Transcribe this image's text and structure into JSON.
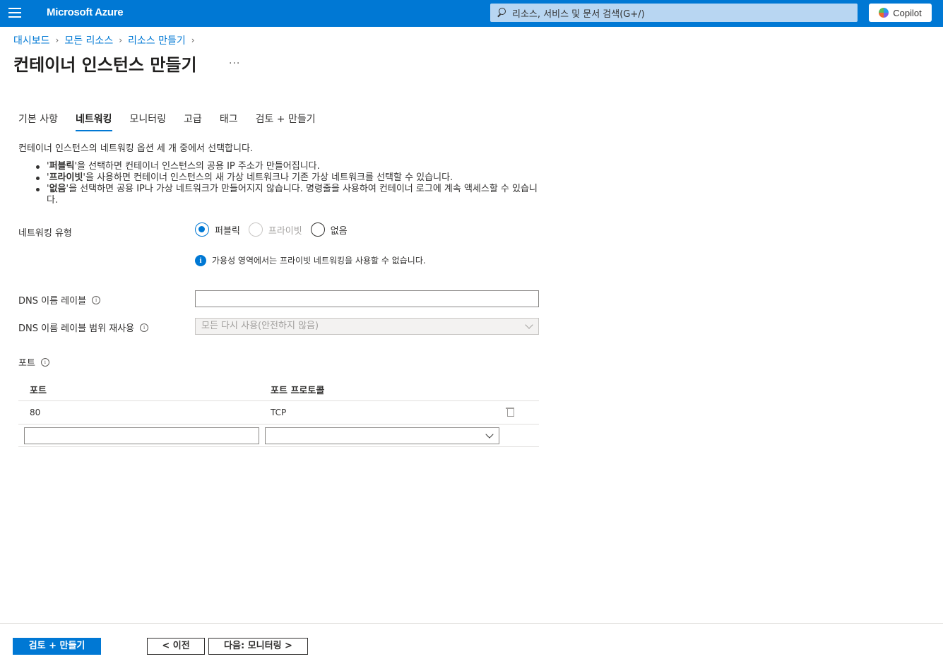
{
  "topbar": {
    "brand": "Microsoft Azure",
    "search_placeholder": "리소스, 서비스 및 문서 검색(G+/)",
    "copilot_label": "Copilot"
  },
  "breadcrumb": [
    "대시보드",
    "모든 리소스",
    "리소스 만들기"
  ],
  "page": {
    "title": "컨테이너 인스턴스 만들기",
    "more": "···"
  },
  "tabs": [
    {
      "label": "기본 사항",
      "active": false
    },
    {
      "label": "네트워킹",
      "active": true
    },
    {
      "label": "모니터링",
      "active": false
    },
    {
      "label": "고급",
      "active": false
    },
    {
      "label": "태그",
      "active": false
    },
    {
      "label": "검토 + 만들기",
      "active": false
    }
  ],
  "intro": "컨테이너 인스턴스의 네트워킹 옵션 세 개 중에서 선택합니다.",
  "bullets": [
    {
      "bold": "퍼블릭",
      "rest": "'을 선택하면 컨테이너 인스턴스의 공용 IP 주소가 만들어집니다."
    },
    {
      "bold": "프라이빗",
      "rest": "'을 사용하면 컨테이너 인스턴스의 새 가상 네트워크나 기존 가상 네트워크를 선택할 수 있습니다."
    },
    {
      "bold": "없음",
      "rest": "'을 선택하면 공용 IP나 가상 네트워크가 만들어지지 않습니다. 명령줄을 사용하여 컨테이너 로그에 계속 액세스할 수 있습니다."
    }
  ],
  "networking_type": {
    "label": "네트워킹 유형",
    "options": [
      {
        "label": "퍼블릭",
        "state": "checked"
      },
      {
        "label": "프라이빗",
        "state": "disabled"
      },
      {
        "label": "없음",
        "state": "unchecked"
      }
    ]
  },
  "notice": "가용성 영역에서는 프라이빗 네트워킹을 사용할 수 없습니다.",
  "dns_label": {
    "label": "DNS 이름 레이블",
    "value": ""
  },
  "dns_scope": {
    "label": "DNS 이름 레이블 범위 재사용",
    "value": "모든 다시 사용(안전하지 않음)"
  },
  "ports": {
    "section_label": "포트",
    "col_port": "포트",
    "col_protocol": "포트 프로토콜",
    "rows": [
      {
        "port": "80",
        "protocol": "TCP"
      }
    ],
    "new_port_value": "",
    "new_protocol_value": ""
  },
  "footer": {
    "review_create": "검토 + 만들기",
    "previous": "< 이전",
    "next": "다음: 모니터링 >"
  },
  "colors": {
    "accent": "#0078d4",
    "text": "#323130",
    "disabled": "#a19f9d"
  }
}
